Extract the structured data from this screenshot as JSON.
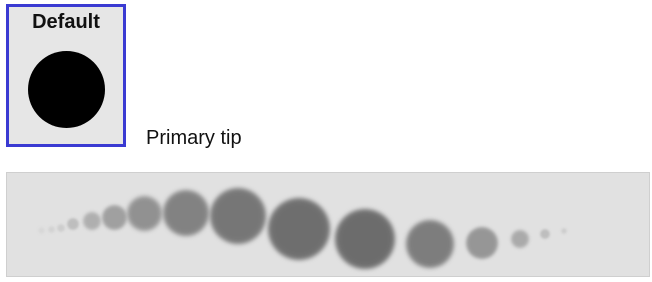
{
  "brush_tip": {
    "title": "Default",
    "icon": "round-brush-tip-icon",
    "selected": true,
    "accent_color": "#3a3ad2",
    "tip_color": "#000000"
  },
  "primary_tip_label": "Primary tip",
  "stroke_preview": {
    "icon": "brush-stroke-preview",
    "background": "#e1e1e1"
  }
}
